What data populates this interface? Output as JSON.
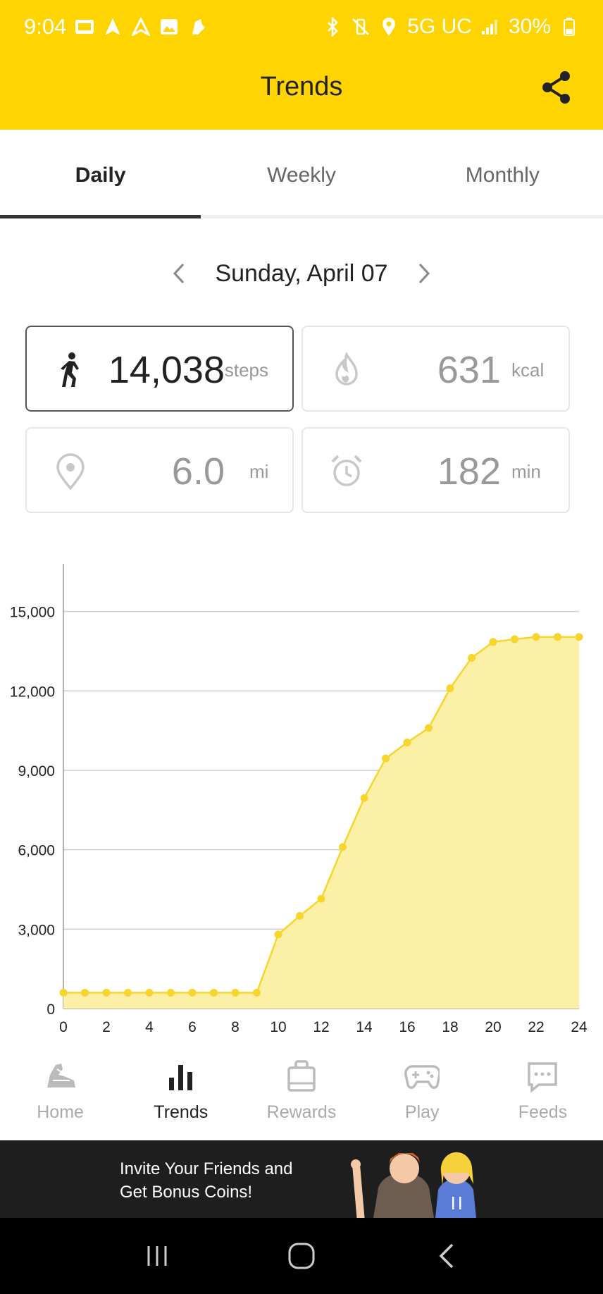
{
  "status_bar": {
    "time": "9:04",
    "network": "5G UC",
    "battery": "30%"
  },
  "app_bar": {
    "title": "Trends",
    "share_icon": "share-icon"
  },
  "tabs": [
    {
      "label": "Daily",
      "active": true
    },
    {
      "label": "Weekly",
      "active": false
    },
    {
      "label": "Monthly",
      "active": false
    }
  ],
  "date_nav": {
    "date": "Sunday, April 07"
  },
  "stats": {
    "steps": {
      "value": "14,038",
      "unit": "steps",
      "icon": "walking-icon"
    },
    "calories": {
      "value": "631",
      "unit": "kcal",
      "icon": "flame-icon"
    },
    "distance": {
      "value": "6.0",
      "unit": "mi",
      "icon": "location-pin-icon"
    },
    "duration": {
      "value": "182",
      "unit": "min",
      "icon": "alarm-clock-icon"
    }
  },
  "chart_data": {
    "type": "area",
    "title": "",
    "xlabel": "",
    "ylabel": "",
    "x": [
      0,
      1,
      2,
      3,
      4,
      5,
      6,
      7,
      8,
      9,
      10,
      11,
      12,
      13,
      14,
      15,
      16,
      17,
      18,
      19,
      20,
      21,
      22,
      23,
      24
    ],
    "values": [
      600,
      600,
      600,
      600,
      600,
      600,
      600,
      600,
      600,
      600,
      2800,
      3500,
      4150,
      6100,
      7950,
      9450,
      10050,
      10600,
      12100,
      13250,
      13850,
      13950,
      14038,
      14038,
      14038
    ],
    "x_ticks": [
      "0",
      "2",
      "4",
      "6",
      "8",
      "10",
      "12",
      "14",
      "16",
      "18",
      "20",
      "22",
      "24"
    ],
    "y_ticks": [
      "0",
      "3,000",
      "6,000",
      "9,000",
      "12,000",
      "15,000"
    ],
    "xlim": [
      0,
      24
    ],
    "ylim": [
      0,
      16800
    ],
    "grid": true,
    "color": "#F7D52C",
    "fill": "#FCEFA6"
  },
  "bottom_nav": [
    {
      "label": "Home",
      "icon": "sneaker-icon",
      "active": false
    },
    {
      "label": "Trends",
      "icon": "bar-chart-icon",
      "active": true
    },
    {
      "label": "Rewards",
      "icon": "shopping-bag-icon",
      "active": false
    },
    {
      "label": "Play",
      "icon": "gamepad-icon",
      "active": false
    },
    {
      "label": "Feeds",
      "icon": "chat-bubble-icon",
      "active": false
    }
  ],
  "banner": {
    "line1": "Invite Your Friends and",
    "line2": "Get Bonus Coins!"
  }
}
